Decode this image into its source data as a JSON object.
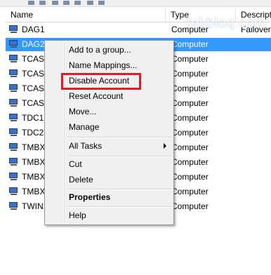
{
  "list": {
    "columns": {
      "name": "Name",
      "type": "Type",
      "description": "Descript"
    },
    "rows": [
      {
        "name": "DAG1",
        "type": "Computer",
        "description": "Failover"
      },
      {
        "name": "DAG2010",
        "type": "Computer",
        "description": "",
        "selected": true
      },
      {
        "name": "TCAS01",
        "type": "Computer",
        "description": ""
      },
      {
        "name": "TCAS02",
        "type": "Computer",
        "description": ""
      },
      {
        "name": "TCAS1",
        "type": "Computer",
        "description": ""
      },
      {
        "name": "TCAS2",
        "type": "Computer",
        "description": ""
      },
      {
        "name": "TDC1",
        "type": "Computer",
        "description": ""
      },
      {
        "name": "TDC2",
        "type": "Computer",
        "description": ""
      },
      {
        "name": "TMBX01",
        "type": "Computer",
        "description": ""
      },
      {
        "name": "TMBX02",
        "type": "Computer",
        "description": ""
      },
      {
        "name": "TMBX1",
        "type": "Computer",
        "description": ""
      },
      {
        "name": "TMBX2",
        "type": "Computer",
        "description": ""
      },
      {
        "name": "TWIN1",
        "type": "Computer",
        "description": ""
      }
    ]
  },
  "context_menu": {
    "add_to_group": "Add to a group...",
    "name_mappings": "Name Mappings...",
    "disable_account": "Disable Account",
    "reset_account": "Reset Account",
    "move": "Move...",
    "manage": "Manage",
    "all_tasks": "All Tasks",
    "cut": "Cut",
    "delete": "Delete",
    "properties": "Properties",
    "help": "Help"
  },
  "watermark": "tekbloq.com",
  "colors": {
    "selection": "#3399ff",
    "highlight_box": "#e21b2b",
    "menu_bg": "#f0f0f0"
  }
}
